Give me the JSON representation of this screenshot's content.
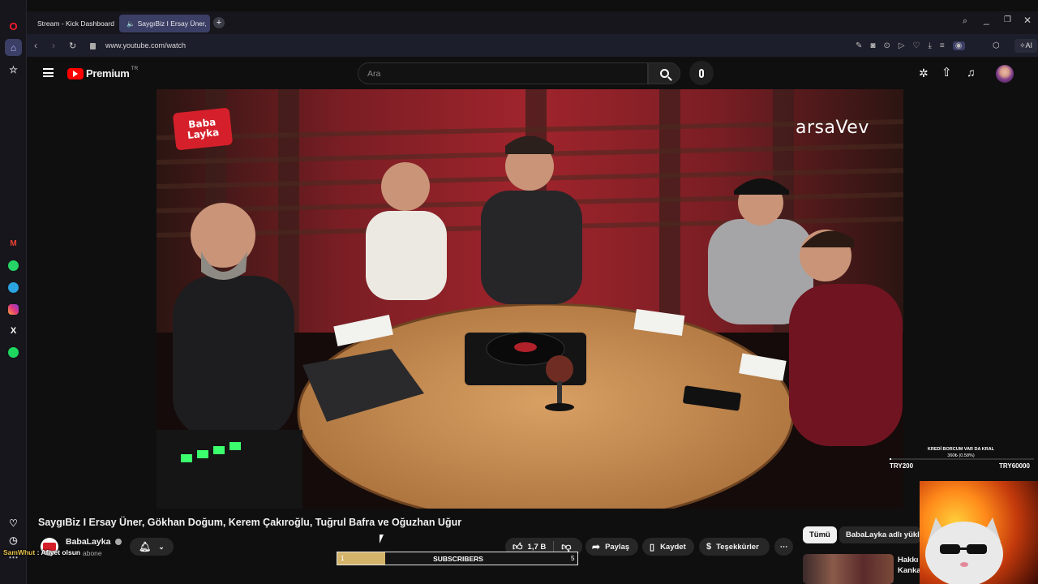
{
  "browser": {
    "tabs": [
      {
        "title": "Stream - Kick Dashboard",
        "icon": "kick-icon"
      },
      {
        "title": "SaygıBiz I Ersay Üner,",
        "icon": "youtube-icon"
      }
    ],
    "url": "www.youtube.com/watch",
    "ai_label": "AI"
  },
  "youtube": {
    "logo_text": "Premium",
    "country": "TR",
    "search_placeholder": "Ara"
  },
  "video": {
    "brand_left": "Baba Layka",
    "brand_right": "arsaVev",
    "title": "SaygıBiz I Ersay Üner, Gökhan Doğum, Kerem Çakıroğlu, Tuğrul Bafra ve Oğuzhan Uğur",
    "channel": "BabaLayka",
    "subscribers": "abone",
    "likes": "1,7 B",
    "share": "Paylaş",
    "save": "Kaydet",
    "thanks": "Teşekkürler"
  },
  "related": {
    "chips": [
      "Tümü",
      "BabaLayka adlı yükley"
    ],
    "first_title_line1": "Hakkı",
    "first_title_line2": "Kanka"
  },
  "overlay": {
    "goal_title": "KREDİ BORCUM VAR DA KRAL",
    "goal_progress": "360₺ (0.58%)",
    "goal_progress_fraction": 0.0058,
    "goal_min": "TRY200",
    "goal_max": "TRY60000",
    "subs_label": "SUBSCRIBERS",
    "subs_start": "1",
    "subs_end": "5",
    "subs_fraction": 0.2,
    "chat_user": "SamWhut",
    "chat_message": "Afiyet olsun",
    "accent": "#d4b46a"
  }
}
